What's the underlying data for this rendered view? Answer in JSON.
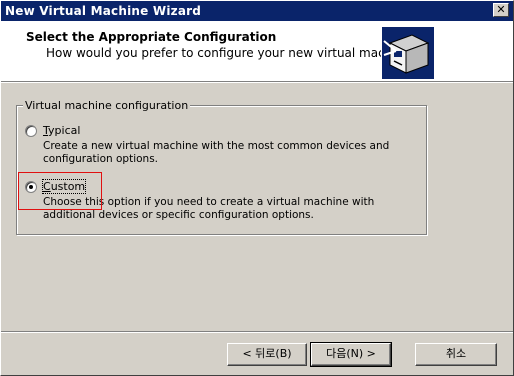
{
  "window": {
    "title": "New Virtual Machine Wizard",
    "close_label": "✕"
  },
  "header": {
    "title": "Select the Appropriate Configuration",
    "subtitle": "How would you prefer to configure your new virtual machine?"
  },
  "group": {
    "legend": "Virtual machine configuration",
    "options": [
      {
        "label_prefix": "",
        "label_accel": "T",
        "label_rest": "ypical",
        "description": "Create a new virtual machine with the most common devices and configuration options.",
        "selected": false
      },
      {
        "label_prefix": "",
        "label_accel": "C",
        "label_rest": "ustom",
        "description": "Choose this option if you need to create a virtual machine with additional devices or specific configuration options.",
        "selected": true
      }
    ]
  },
  "buttons": {
    "back": "< 뒤로(B)",
    "next": "다음(N) >",
    "cancel": "취소"
  },
  "colors": {
    "titlebar": "#0a246a",
    "face": "#d4d0c8",
    "highlight_box": "#e01010"
  }
}
